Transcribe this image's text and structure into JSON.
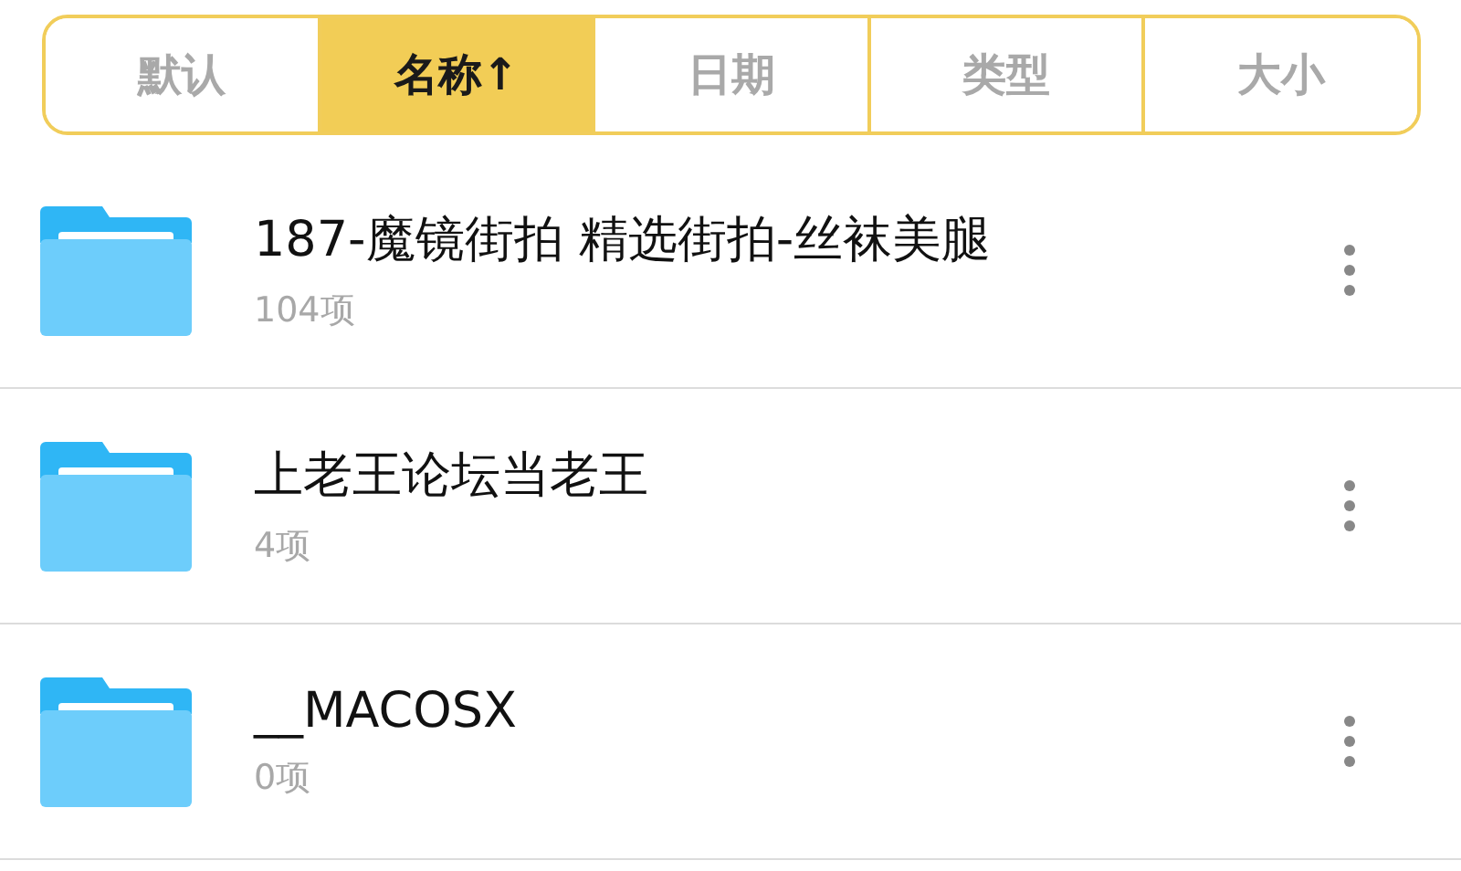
{
  "sort_tabs": [
    {
      "label": "默认",
      "selected": false
    },
    {
      "label": "名称↑",
      "selected": true
    },
    {
      "label": "日期",
      "selected": false
    },
    {
      "label": "类型",
      "selected": false
    },
    {
      "label": "大小",
      "selected": false
    }
  ],
  "folders": [
    {
      "name": "187-魔镜街拍 精选街拍-丝袜美腿",
      "count": "104项"
    },
    {
      "name": "上老王论坛当老王",
      "count": "4项"
    },
    {
      "name": "__MACOSX",
      "count": "0项"
    }
  ]
}
